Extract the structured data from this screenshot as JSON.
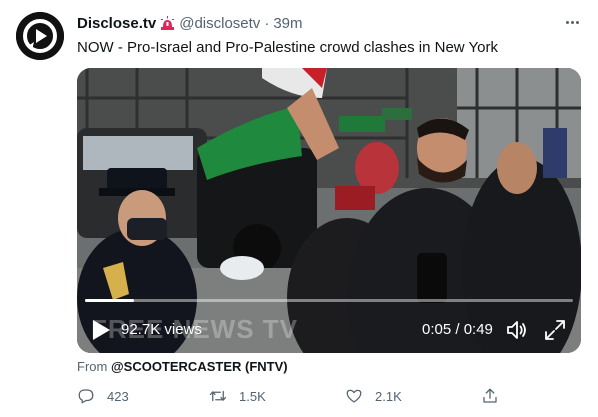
{
  "tweet": {
    "author_name": "Disclose.tv",
    "badge_icon": "siren-icon",
    "handle": "@disclosetv",
    "separator": "·",
    "time": "39m",
    "text": "NOW - Pro-Israel and Pro-Palestine crowd clashes in New York",
    "more_icon": "more-icon"
  },
  "video": {
    "views": "92.7K views",
    "watermark": "FREE NEWS TV",
    "timecode": "0:05 / 0:49",
    "progress_fraction": 0.1,
    "play_icon": "play-icon",
    "volume_icon": "volume-icon",
    "fullscreen_icon": "fullscreen-icon"
  },
  "source": {
    "prefix": "From",
    "account": "@SCOOTERCASTER (FNTV)"
  },
  "actions": {
    "reply_count": "423",
    "retweet_count": "1.5K",
    "like_count": "2.1K"
  },
  "colors": {
    "secondary_text": "#536471",
    "primary_text": "#0f1419"
  }
}
